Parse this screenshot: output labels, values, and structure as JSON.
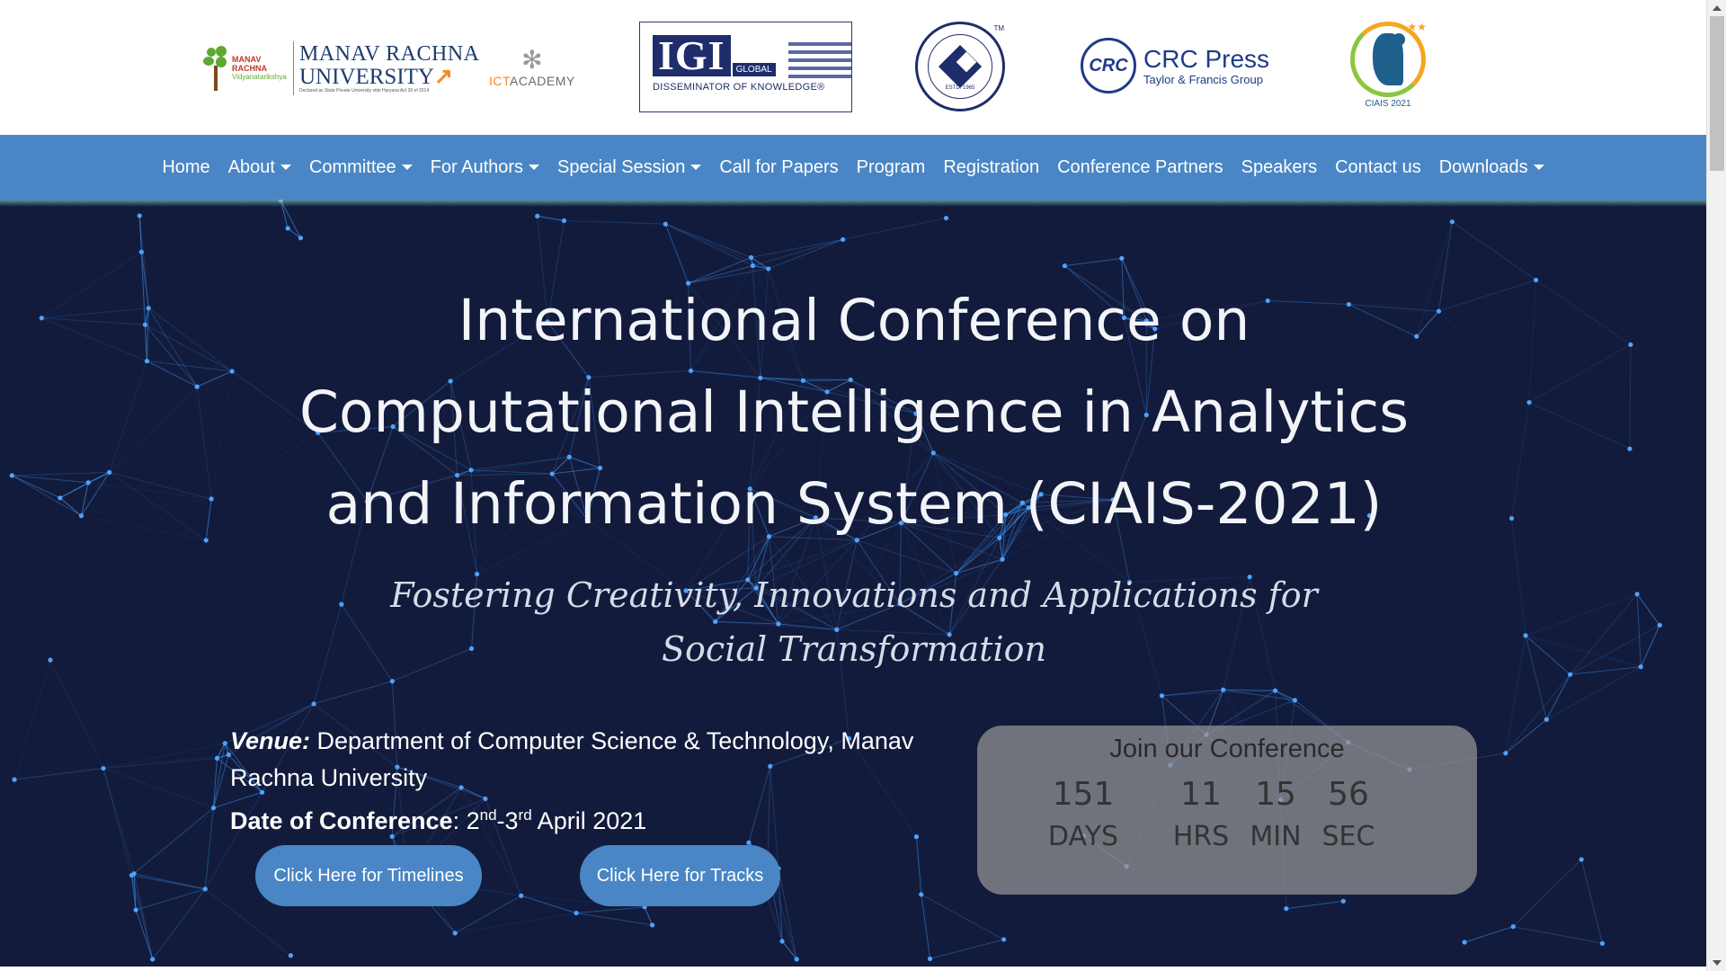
{
  "logos": {
    "manav_rachna": {
      "small": "MANAV RACHNA",
      "small_sub": "Vidyanatarikshya",
      "line1": "MANAV RACHNA",
      "line2": "UNIVERSITY",
      "line3": "Declared as State Private University vide Haryana Act 26 of 2014"
    },
    "ict": {
      "prefix": "ICT",
      "suffix": "ACADEMY"
    },
    "igi": {
      "name": "IGI",
      "global": "GLOBAL",
      "tagline": "DISSEMINATOR OF KNOWLEDGE®"
    },
    "csi": {
      "est": "ESTD. 1965",
      "tm": "TM",
      "icon": "csi-emblem-icon"
    },
    "crc": {
      "mark": "CRC",
      "name": "CRC Press",
      "sub": "Taylor & Francis Group"
    },
    "ciais": {
      "label": "CIAIS 2021",
      "stars": "★★"
    }
  },
  "nav": {
    "items": [
      {
        "label": "Home",
        "dropdown": false
      },
      {
        "label": "About",
        "dropdown": true
      },
      {
        "label": "Committee",
        "dropdown": true
      },
      {
        "label": "For Authors",
        "dropdown": true
      },
      {
        "label": "Special Session",
        "dropdown": true
      },
      {
        "label": "Call for Papers",
        "dropdown": false
      },
      {
        "label": "Program",
        "dropdown": false
      },
      {
        "label": "Registration",
        "dropdown": false
      },
      {
        "label": "Conference Partners",
        "dropdown": false
      },
      {
        "label": "Speakers",
        "dropdown": false
      },
      {
        "label": "Contact us",
        "dropdown": false
      },
      {
        "label": "Downloads",
        "dropdown": true
      }
    ]
  },
  "hero": {
    "title_lines": [
      "International Conference on",
      "Computational Intelligence in Analytics",
      "and Information System (CIAIS-2021)"
    ],
    "subtitle": "Fostering Creativity, Innovations and Applications for Social Transformation",
    "venue_label": "Venue:",
    "venue_text": " Department of Computer Science & Technology, Manav Rachna University",
    "date_label": "Date of Conference",
    "date_colon": ": ",
    "date_d1": "2",
    "date_sup1": "nd",
    "date_dash": "-3",
    "date_sup2": "rd",
    "date_rest": " April 2021",
    "btn_timelines": "Click Here for Timelines",
    "btn_tracks": "Click Here for Tracks"
  },
  "countdown": {
    "heading": "Join our Conference",
    "cells": [
      {
        "num": "151",
        "unit": "DAYS"
      },
      {
        "num": "11",
        "unit": "HRS"
      },
      {
        "num": "15",
        "unit": "MIN"
      },
      {
        "num": "56",
        "unit": "SEC"
      }
    ]
  },
  "colors": {
    "nav_bg": "#4a86c5",
    "hero_bg": "#131b3c",
    "network_line": "#3a8ee6",
    "button_bg": "#4a86c5"
  }
}
